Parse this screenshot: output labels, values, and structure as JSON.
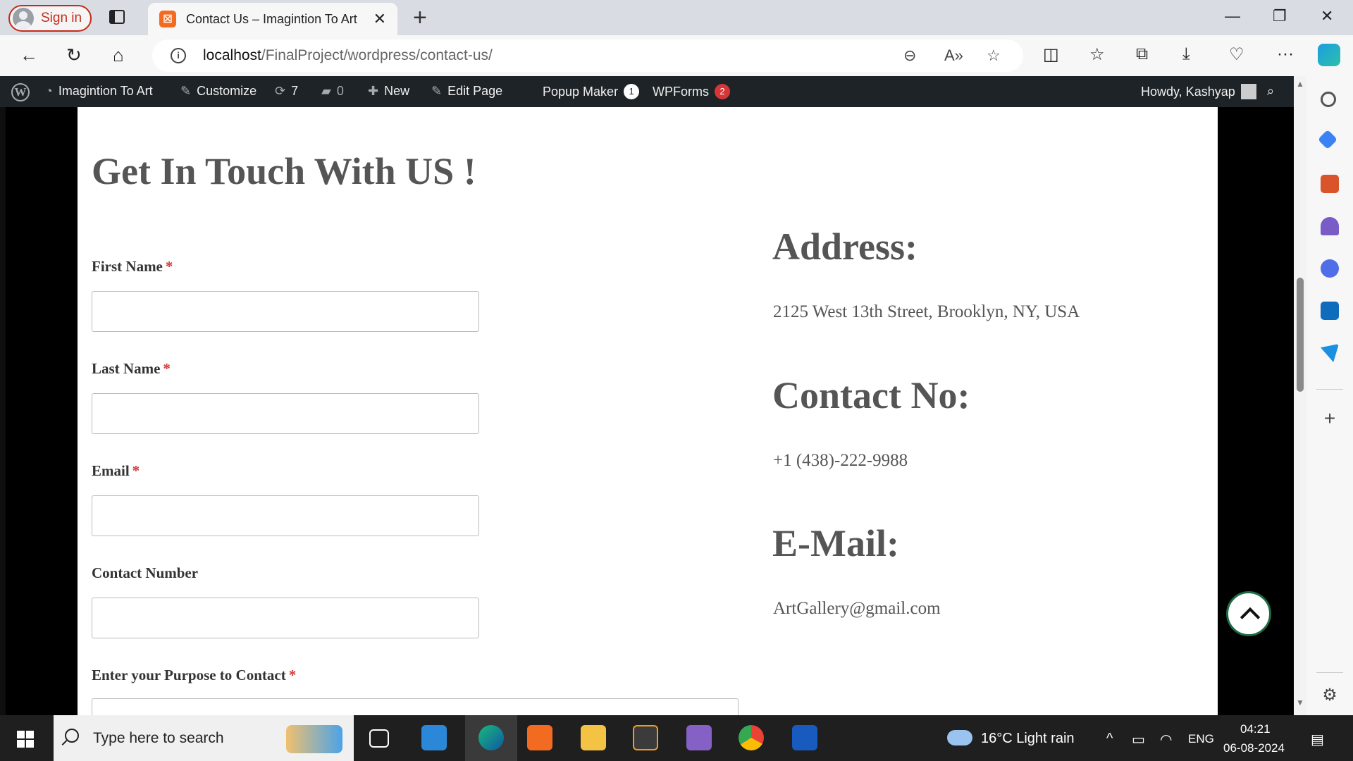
{
  "browser": {
    "signin_label": "Sign in",
    "tab_title": "Contact Us – Imagintion To Art",
    "tab_favicon": "xampp-icon",
    "url_host": "localhost",
    "url_path": "/FinalProject/wordpress/contact-us/"
  },
  "wp_admin_bar": {
    "site_name": "Imagintion To Art",
    "customize": "Customize",
    "updates_count": "7",
    "comments_count": "0",
    "new_label": "New",
    "edit_page": "Edit Page",
    "popup_maker": "Popup Maker",
    "popup_maker_badge": "1",
    "wpforms": "WPForms",
    "wpforms_badge": "2",
    "howdy": "Howdy, Kashyap"
  },
  "page": {
    "title": "Get In Touch With US !",
    "required_mark": "*",
    "fields": [
      {
        "label": "First Name",
        "required": true,
        "value": ""
      },
      {
        "label": "Last Name",
        "required": true,
        "value": ""
      },
      {
        "label": "Email",
        "required": true,
        "value": ""
      },
      {
        "label": "Contact Number",
        "required": false,
        "value": ""
      },
      {
        "label": "Enter your Purpose to Contact",
        "required": true,
        "value": ""
      }
    ],
    "info": {
      "address_heading": "Address:",
      "address": "2125 West 13th Street, Brooklyn, NY, USA",
      "contact_heading": "Contact No:",
      "contact": "+1 (438)-222-9988",
      "email_heading": "E-Mail:",
      "email": "ArtGallery@gmail.com"
    }
  },
  "taskbar": {
    "search_placeholder": "Type here to search",
    "weather": "16°C  Light rain",
    "language": "ENG",
    "time": "04:21",
    "date": "06-08-2024"
  },
  "colors": {
    "wp_bar": "#1d2327",
    "required": "#d63638",
    "badge_red": "#d63638",
    "signin_red": "#c42b1c"
  }
}
